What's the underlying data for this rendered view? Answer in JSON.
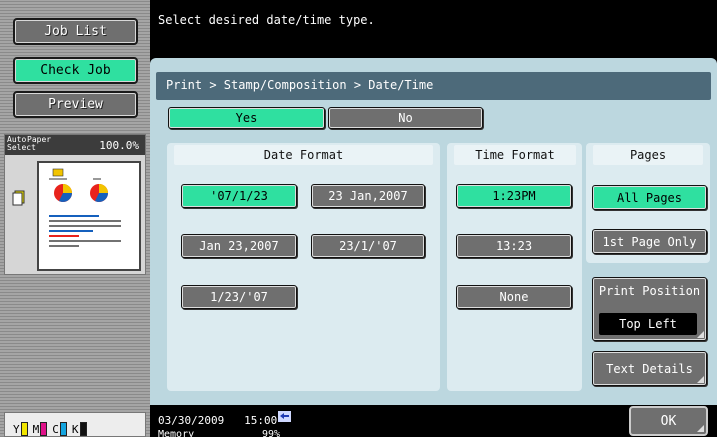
{
  "sidebar": {
    "job_list": "Job List",
    "check_job": "Check Job",
    "preview": "Preview",
    "auto": "Auto",
    "paper": "Paper",
    "select": "Select",
    "zoom": "100.0%",
    "toners": [
      {
        "label": "Y",
        "color": "#f2e600"
      },
      {
        "label": "M",
        "color": "#e0128a"
      },
      {
        "label": "C",
        "color": "#14a5e0"
      },
      {
        "label": "K",
        "color": "#111111"
      }
    ]
  },
  "message": "Select desired date/time type.",
  "breadcrumb": "Print > Stamp/Composition > Date/Time",
  "toggle": {
    "yes": "Yes",
    "no": "No",
    "selected": "Yes"
  },
  "date_format": {
    "header": "Date Format",
    "options": [
      "'07/1/23",
      "23 Jan,2007",
      "Jan 23,2007",
      "23/1/'07",
      "1/23/'07"
    ],
    "selected": "'07/1/23"
  },
  "time_format": {
    "header": "Time Format",
    "options": [
      "1:23PM",
      "13:23",
      "None"
    ],
    "selected": "1:23PM"
  },
  "pages": {
    "header": "Pages",
    "all": "All Pages",
    "first": "1st Page Only",
    "selected": "All Pages"
  },
  "print_position": {
    "label": "Print Position",
    "value": "Top Left"
  },
  "text_details": "Text Details",
  "status": {
    "date": "03/30/2009",
    "time": "15:00",
    "memory_label": "Memory",
    "memory_value": "99%"
  },
  "ok": "OK",
  "colors": {
    "accent_green": "#2fe0a0",
    "button_gray": "#6f6f6f",
    "panel_blue": "#bcd7df",
    "bar_blue": "#4d6a7a"
  }
}
